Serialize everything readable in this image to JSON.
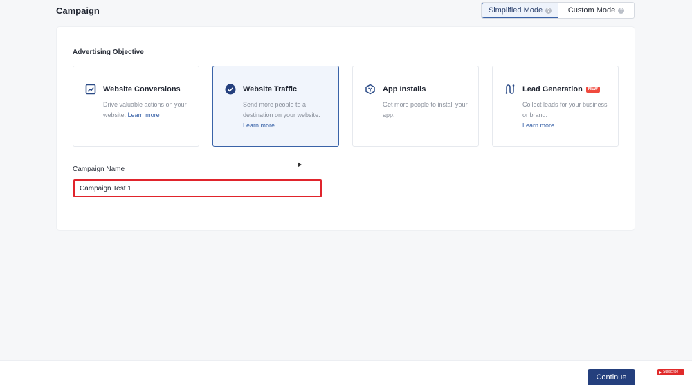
{
  "header": {
    "title": "Campaign",
    "modes": [
      {
        "label": "Simplified Mode",
        "active": true
      },
      {
        "label": "Custom Mode",
        "active": false
      }
    ]
  },
  "objective": {
    "section_label": "Advertising Objective",
    "cards": [
      {
        "title": "Website Conversions",
        "desc": "Drive valuable actions on your website.",
        "learn_more": "Learn more",
        "icon": "chart-up-icon",
        "selected": false
      },
      {
        "title": "Website Traffic",
        "desc": "Send more people to a destination on your website.",
        "learn_more": "Learn more",
        "icon": "check-circle-icon",
        "selected": true
      },
      {
        "title": "App Installs",
        "desc": "Get more people to install your app.",
        "icon": "cube-icon",
        "selected": false
      },
      {
        "title": "Lead Generation",
        "badge": "NEW",
        "desc": "Collect leads for your business or brand.",
        "learn_more": "Learn more",
        "icon": "route-icon",
        "selected": false
      }
    ]
  },
  "campaign_name": {
    "label": "Campaign Name",
    "value": "Campaign Test 1"
  },
  "footer": {
    "continue_label": "Continue",
    "subscribe_label": "Subscribe"
  },
  "colors": {
    "accent": "#243f7d",
    "selected_border": "#3a63a8",
    "highlight_red": "#e0242c"
  }
}
